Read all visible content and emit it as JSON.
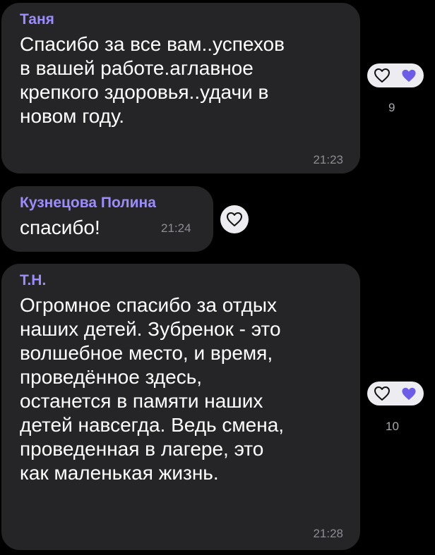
{
  "messages": [
    {
      "author": "Таня",
      "lines": [
        "Спасибо за все вам..успехов",
        "в вашей работе.аглавное",
        "крепкого здоровья..удачи в",
        "новом году."
      ],
      "time": "21:23",
      "reaction_count": "9"
    },
    {
      "author": "Кузнецова Полина",
      "lines": [
        "спасибо!"
      ],
      "time": "21:24",
      "reaction_count": ""
    },
    {
      "author": "Т.Н.",
      "lines": [
        "Огромное спасибо за отдых",
        "наших детей. Зубренок - это",
        "волшебное место, и время,",
        "проведённое здесь,",
        "останется в памяти наших",
        "детей навсегда. Ведь смена,",
        "проведенная в лагере, это",
        "как маленькая жизнь."
      ],
      "time": "21:28",
      "reaction_count": "10"
    }
  ],
  "icons": {
    "add_reaction": "heart-outline-icon",
    "reaction": "purple-heart-icon"
  },
  "colors": {
    "background": "#000000",
    "bubble": "#252528",
    "author": "#9b8cff",
    "text": "#ffffff",
    "time": "#8c8c93",
    "heart_fill": "#6c5ce7"
  }
}
